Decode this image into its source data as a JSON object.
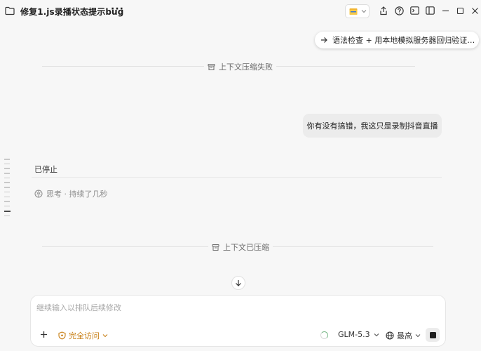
{
  "titlebar": {
    "title": "修复1.js录播状态提示bug",
    "more": "···"
  },
  "task_pill": {
    "text": "语法检查 + 用本地模拟服务器回归验证四..."
  },
  "dividers": {
    "compress_failed": "上下文压缩失败",
    "compressed": "上下文已压缩"
  },
  "messages": {
    "user": "你有没有搞错，我这只是录制抖音直播",
    "stopped": "已停止",
    "thinking": "思考 · 持续了几秒"
  },
  "composer": {
    "placeholder": "继续输入以排队后续修改",
    "access_label": "完全访问",
    "model": "GLM-5.3",
    "level": "最高"
  },
  "colors": {
    "background": "#f7f7f7",
    "access_accent": "#c77d12",
    "spinner": "#7bb889"
  },
  "icons": [
    "folder-icon",
    "app-folder-icon",
    "share-icon",
    "help-icon",
    "terminal-icon",
    "panel-icon",
    "minimize-icon",
    "maximize-icon",
    "close-icon",
    "arrow-right-icon",
    "archive-icon",
    "brain-icon",
    "arrow-down-icon",
    "plus-icon",
    "shield-icon",
    "globe-icon",
    "stop-icon"
  ]
}
